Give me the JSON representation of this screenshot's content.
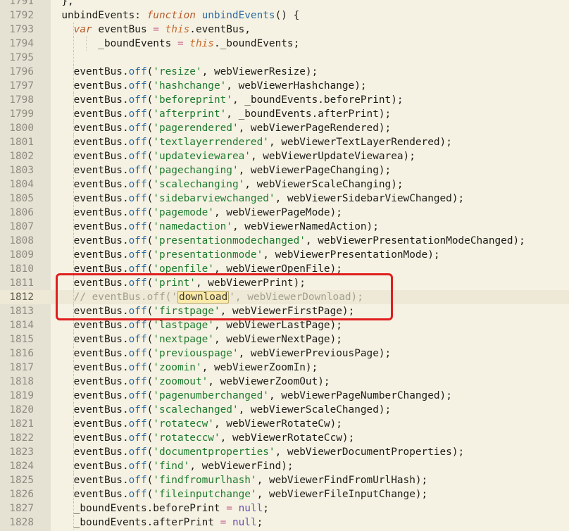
{
  "editor": {
    "highlight_term": "download",
    "lines": [
      {
        "n": "1791",
        "t": [
          [
            "pun",
            "  },"
          ]
        ]
      },
      {
        "n": "1792",
        "t": [
          [
            "key",
            "  unbindEvents"
          ],
          [
            "pun",
            ": "
          ],
          [
            "kw",
            "function"
          ],
          [
            "pun",
            " "
          ],
          [
            "fn",
            "unbindEvents"
          ],
          [
            "pun",
            "() {"
          ]
        ]
      },
      {
        "n": "1793",
        "t": [
          [
            "pun",
            "    "
          ],
          [
            "kw",
            "var"
          ],
          [
            "id",
            " eventBus "
          ],
          [
            "op",
            "="
          ],
          [
            "pun",
            " "
          ],
          [
            "this",
            "this"
          ],
          [
            "pun",
            ".eventBus,"
          ]
        ]
      },
      {
        "n": "1794",
        "t": [
          [
            "id",
            "        _boundEvents "
          ],
          [
            "op",
            "="
          ],
          [
            "pun",
            " "
          ],
          [
            "this",
            "this"
          ],
          [
            "pun",
            "._boundEvents;"
          ]
        ]
      },
      {
        "n": "1795",
        "t": [
          [
            "pun",
            ""
          ]
        ]
      },
      {
        "n": "1796",
        "t": [
          [
            "id",
            "    eventBus."
          ],
          [
            "meth",
            "off"
          ],
          [
            "pun",
            "("
          ],
          [
            "str",
            "'resize'"
          ],
          [
            "pun",
            ", webViewerResize);"
          ]
        ]
      },
      {
        "n": "1797",
        "t": [
          [
            "id",
            "    eventBus."
          ],
          [
            "meth",
            "off"
          ],
          [
            "pun",
            "("
          ],
          [
            "str",
            "'hashchange'"
          ],
          [
            "pun",
            ", webViewerHashchange);"
          ]
        ]
      },
      {
        "n": "1798",
        "t": [
          [
            "id",
            "    eventBus."
          ],
          [
            "meth",
            "off"
          ],
          [
            "pun",
            "("
          ],
          [
            "str",
            "'beforeprint'"
          ],
          [
            "pun",
            ", _boundEvents.beforePrint);"
          ]
        ]
      },
      {
        "n": "1799",
        "t": [
          [
            "id",
            "    eventBus."
          ],
          [
            "meth",
            "off"
          ],
          [
            "pun",
            "("
          ],
          [
            "str",
            "'afterprint'"
          ],
          [
            "pun",
            ", _boundEvents.afterPrint);"
          ]
        ]
      },
      {
        "n": "1800",
        "t": [
          [
            "id",
            "    eventBus."
          ],
          [
            "meth",
            "off"
          ],
          [
            "pun",
            "("
          ],
          [
            "str",
            "'pagerendered'"
          ],
          [
            "pun",
            ", webViewerPageRendered);"
          ]
        ]
      },
      {
        "n": "1801",
        "t": [
          [
            "id",
            "    eventBus."
          ],
          [
            "meth",
            "off"
          ],
          [
            "pun",
            "("
          ],
          [
            "str",
            "'textlayerrendered'"
          ],
          [
            "pun",
            ", webViewerTextLayerRendered);"
          ]
        ]
      },
      {
        "n": "1802",
        "t": [
          [
            "id",
            "    eventBus."
          ],
          [
            "meth",
            "off"
          ],
          [
            "pun",
            "("
          ],
          [
            "str",
            "'updateviewarea'"
          ],
          [
            "pun",
            ", webViewerUpdateViewarea);"
          ]
        ]
      },
      {
        "n": "1803",
        "t": [
          [
            "id",
            "    eventBus."
          ],
          [
            "meth",
            "off"
          ],
          [
            "pun",
            "("
          ],
          [
            "str",
            "'pagechanging'"
          ],
          [
            "pun",
            ", webViewerPageChanging);"
          ]
        ]
      },
      {
        "n": "1804",
        "t": [
          [
            "id",
            "    eventBus."
          ],
          [
            "meth",
            "off"
          ],
          [
            "pun",
            "("
          ],
          [
            "str",
            "'scalechanging'"
          ],
          [
            "pun",
            ", webViewerScaleChanging);"
          ]
        ]
      },
      {
        "n": "1805",
        "t": [
          [
            "id",
            "    eventBus."
          ],
          [
            "meth",
            "off"
          ],
          [
            "pun",
            "("
          ],
          [
            "str",
            "'sidebarviewchanged'"
          ],
          [
            "pun",
            ", webViewerSidebarViewChanged);"
          ]
        ]
      },
      {
        "n": "1806",
        "t": [
          [
            "id",
            "    eventBus."
          ],
          [
            "meth",
            "off"
          ],
          [
            "pun",
            "("
          ],
          [
            "str",
            "'pagemode'"
          ],
          [
            "pun",
            ", webViewerPageMode);"
          ]
        ]
      },
      {
        "n": "1807",
        "t": [
          [
            "id",
            "    eventBus."
          ],
          [
            "meth",
            "off"
          ],
          [
            "pun",
            "("
          ],
          [
            "str",
            "'namedaction'"
          ],
          [
            "pun",
            ", webViewerNamedAction);"
          ]
        ]
      },
      {
        "n": "1808",
        "t": [
          [
            "id",
            "    eventBus."
          ],
          [
            "meth",
            "off"
          ],
          [
            "pun",
            "("
          ],
          [
            "str",
            "'presentationmodechanged'"
          ],
          [
            "pun",
            ", webViewerPresentationModeChanged);"
          ]
        ]
      },
      {
        "n": "1809",
        "t": [
          [
            "id",
            "    eventBus."
          ],
          [
            "meth",
            "off"
          ],
          [
            "pun",
            "("
          ],
          [
            "str",
            "'presentationmode'"
          ],
          [
            "pun",
            ", webViewerPresentationMode);"
          ]
        ]
      },
      {
        "n": "1810",
        "t": [
          [
            "id",
            "    eventBus."
          ],
          [
            "meth",
            "off"
          ],
          [
            "pun",
            "("
          ],
          [
            "str",
            "'openfile'"
          ],
          [
            "pun",
            ", webViewerOpenFile);"
          ]
        ]
      },
      {
        "n": "1811",
        "t": [
          [
            "id",
            "    eventBus."
          ],
          [
            "meth",
            "off"
          ],
          [
            "pun",
            "("
          ],
          [
            "str",
            "'print'"
          ],
          [
            "pun",
            ", webViewerPrint);"
          ]
        ]
      },
      {
        "n": "1812",
        "current": true,
        "t": [
          [
            "comment",
            "    // eventBus.off('"
          ],
          [
            "hl",
            "download"
          ],
          [
            "comment",
            "', webViewerDownload);"
          ]
        ]
      },
      {
        "n": "1813",
        "t": [
          [
            "id",
            "    eventBus."
          ],
          [
            "meth",
            "off"
          ],
          [
            "pun",
            "("
          ],
          [
            "str",
            "'firstpage'"
          ],
          [
            "pun",
            ", webViewerFirstPage);"
          ]
        ]
      },
      {
        "n": "1814",
        "t": [
          [
            "id",
            "    eventBus."
          ],
          [
            "meth",
            "off"
          ],
          [
            "pun",
            "("
          ],
          [
            "str",
            "'lastpage'"
          ],
          [
            "pun",
            ", webViewerLastPage);"
          ]
        ]
      },
      {
        "n": "1815",
        "t": [
          [
            "id",
            "    eventBus."
          ],
          [
            "meth",
            "off"
          ],
          [
            "pun",
            "("
          ],
          [
            "str",
            "'nextpage'"
          ],
          [
            "pun",
            ", webViewerNextPage);"
          ]
        ]
      },
      {
        "n": "1816",
        "t": [
          [
            "id",
            "    eventBus."
          ],
          [
            "meth",
            "off"
          ],
          [
            "pun",
            "("
          ],
          [
            "str",
            "'previouspage'"
          ],
          [
            "pun",
            ", webViewerPreviousPage);"
          ]
        ]
      },
      {
        "n": "1817",
        "t": [
          [
            "id",
            "    eventBus."
          ],
          [
            "meth",
            "off"
          ],
          [
            "pun",
            "("
          ],
          [
            "str",
            "'zoomin'"
          ],
          [
            "pun",
            ", webViewerZoomIn);"
          ]
        ]
      },
      {
        "n": "1818",
        "t": [
          [
            "id",
            "    eventBus."
          ],
          [
            "meth",
            "off"
          ],
          [
            "pun",
            "("
          ],
          [
            "str",
            "'zoomout'"
          ],
          [
            "pun",
            ", webViewerZoomOut);"
          ]
        ]
      },
      {
        "n": "1819",
        "t": [
          [
            "id",
            "    eventBus."
          ],
          [
            "meth",
            "off"
          ],
          [
            "pun",
            "("
          ],
          [
            "str",
            "'pagenumberchanged'"
          ],
          [
            "pun",
            ", webViewerPageNumberChanged);"
          ]
        ]
      },
      {
        "n": "1820",
        "t": [
          [
            "id",
            "    eventBus."
          ],
          [
            "meth",
            "off"
          ],
          [
            "pun",
            "("
          ],
          [
            "str",
            "'scalechanged'"
          ],
          [
            "pun",
            ", webViewerScaleChanged);"
          ]
        ]
      },
      {
        "n": "1821",
        "t": [
          [
            "id",
            "    eventBus."
          ],
          [
            "meth",
            "off"
          ],
          [
            "pun",
            "("
          ],
          [
            "str",
            "'rotatecw'"
          ],
          [
            "pun",
            ", webViewerRotateCw);"
          ]
        ]
      },
      {
        "n": "1822",
        "t": [
          [
            "id",
            "    eventBus."
          ],
          [
            "meth",
            "off"
          ],
          [
            "pun",
            "("
          ],
          [
            "str",
            "'rotateccw'"
          ],
          [
            "pun",
            ", webViewerRotateCcw);"
          ]
        ]
      },
      {
        "n": "1823",
        "t": [
          [
            "id",
            "    eventBus."
          ],
          [
            "meth",
            "off"
          ],
          [
            "pun",
            "("
          ],
          [
            "str",
            "'documentproperties'"
          ],
          [
            "pun",
            ", webViewerDocumentProperties);"
          ]
        ]
      },
      {
        "n": "1824",
        "t": [
          [
            "id",
            "    eventBus."
          ],
          [
            "meth",
            "off"
          ],
          [
            "pun",
            "("
          ],
          [
            "str",
            "'find'"
          ],
          [
            "pun",
            ", webViewerFind);"
          ]
        ]
      },
      {
        "n": "1825",
        "t": [
          [
            "id",
            "    eventBus."
          ],
          [
            "meth",
            "off"
          ],
          [
            "pun",
            "("
          ],
          [
            "str",
            "'findfromurlhash'"
          ],
          [
            "pun",
            ", webViewerFindFromUrlHash);"
          ]
        ]
      },
      {
        "n": "1826",
        "t": [
          [
            "id",
            "    eventBus."
          ],
          [
            "meth",
            "off"
          ],
          [
            "pun",
            "("
          ],
          [
            "str",
            "'fileinputchange'"
          ],
          [
            "pun",
            ", webViewerFileInputChange);"
          ]
        ]
      },
      {
        "n": "1827",
        "t": [
          [
            "id",
            "    _boundEvents.beforePrint "
          ],
          [
            "op",
            "="
          ],
          [
            "pun",
            " "
          ],
          [
            "lit",
            "null"
          ],
          [
            "pun",
            ";"
          ]
        ]
      },
      {
        "n": "1828",
        "t": [
          [
            "id",
            "    _boundEvents.afterPrint "
          ],
          [
            "op",
            "="
          ],
          [
            "pun",
            " "
          ],
          [
            "lit",
            "null"
          ],
          [
            "pun",
            ";"
          ]
        ]
      }
    ]
  }
}
